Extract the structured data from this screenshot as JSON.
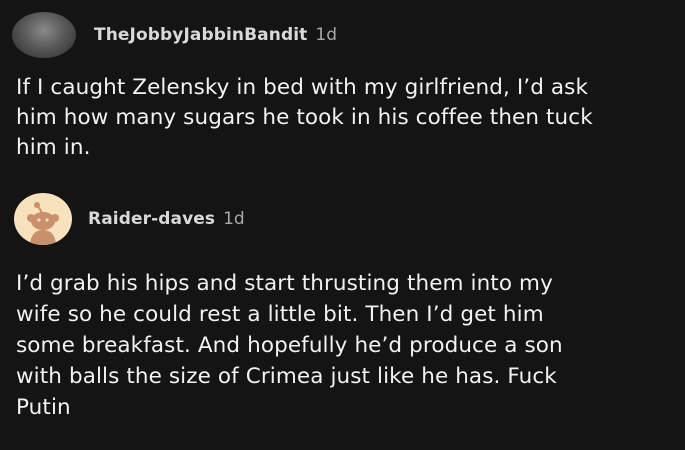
{
  "comments": [
    {
      "username": "TheJobbyJabbinBandit",
      "timestamp": "1d",
      "avatar_icon": "user-avatar-photo",
      "body": "If I caught Zelensky in bed with my girlfriend, I’d ask\nhim how many sugars he took in his coffee then tuck\nhim in."
    },
    {
      "username": "Raider-daves",
      "timestamp": "1d",
      "avatar_icon": "reddit-snoo-avatar",
      "body": "I’d grab his hips and start thrusting them into my\nwife so he could rest a little bit. Then I’d get him\nsome breakfast. And hopefully he’d produce a son\nwith balls the size of Crimea just like he has. Fuck\nPutin"
    }
  ],
  "colors": {
    "background": "#141414",
    "username": "#d9d9d9",
    "timestamp": "#a8a8a8",
    "body_text": "#f2f2f2",
    "snoo_avatar_bg": "#f6e2bd",
    "snoo_body": "#c9906b"
  }
}
